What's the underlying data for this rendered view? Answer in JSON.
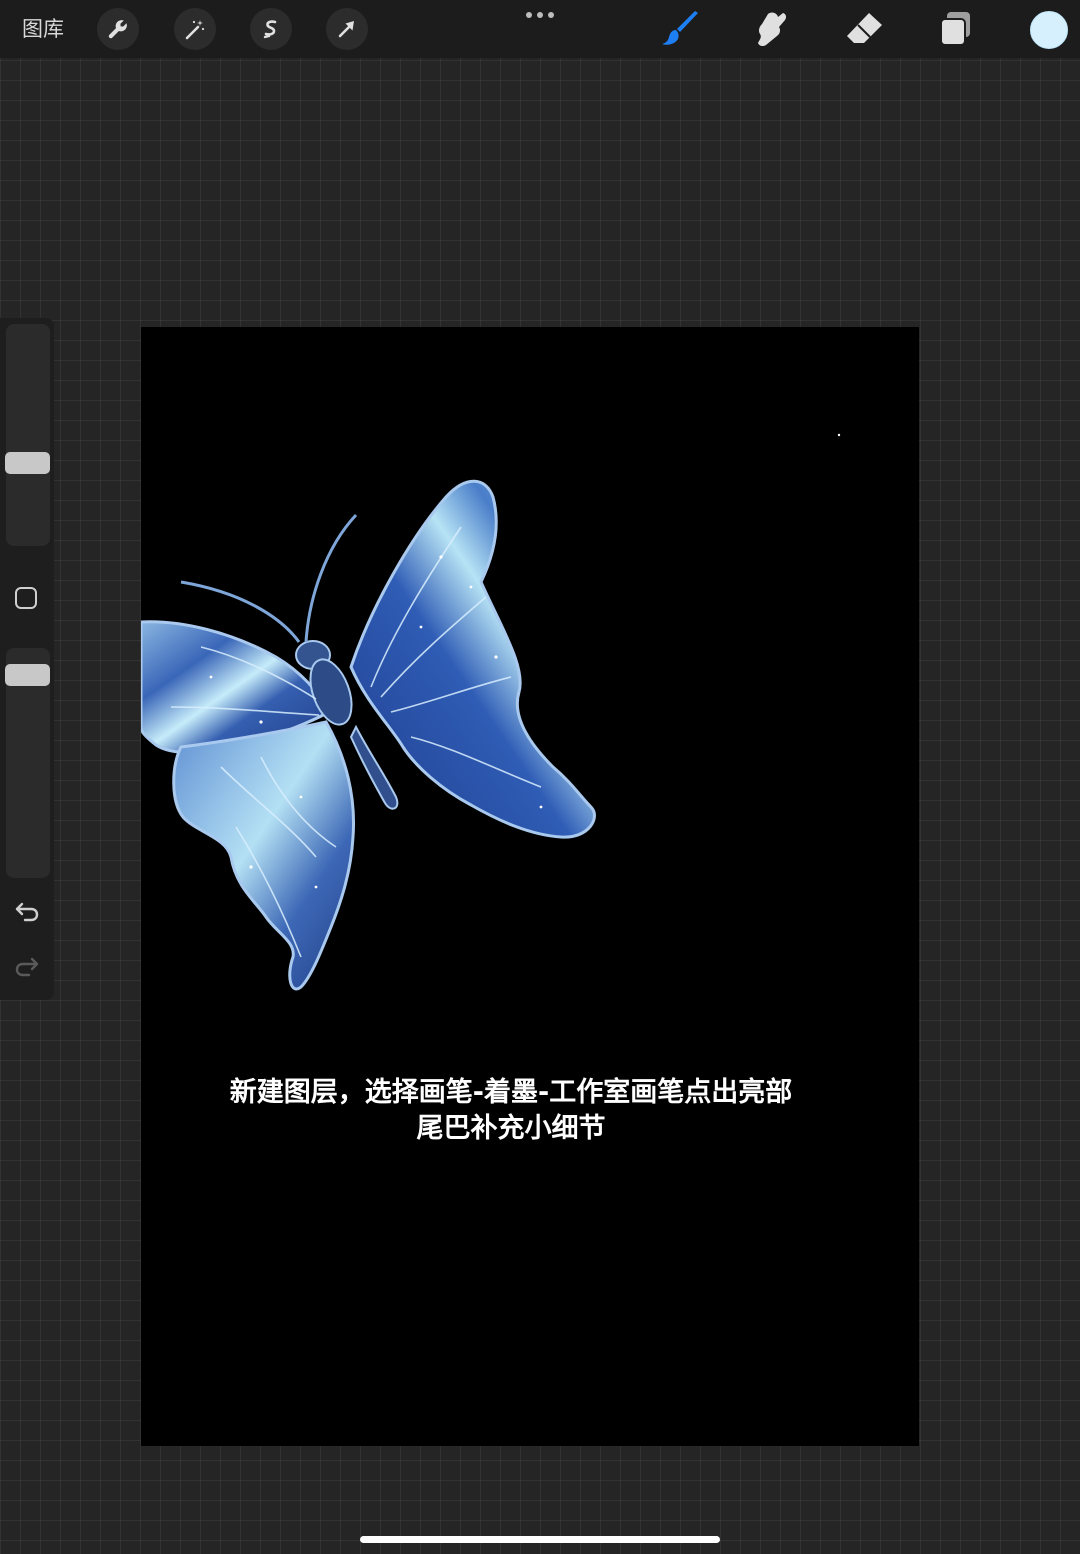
{
  "toolbar": {
    "gallery_label": "图库",
    "left_tools": [
      {
        "icon": "wrench-icon",
        "name": "actions"
      },
      {
        "icon": "magic-wand-icon",
        "name": "adjustments"
      },
      {
        "icon": "selection-icon",
        "name": "selection"
      },
      {
        "icon": "arrow-cursor-icon",
        "name": "transform"
      }
    ],
    "more_icon": "ellipsis-icon",
    "right_tools": [
      {
        "icon": "brush-icon",
        "name": "paint",
        "active": true
      },
      {
        "icon": "smudge-icon",
        "name": "smudge",
        "active": false
      },
      {
        "icon": "eraser-icon",
        "name": "erase",
        "active": false
      },
      {
        "icon": "layers-icon",
        "name": "layers",
        "active": false
      }
    ],
    "active_color": "#d6f0fd",
    "accent_color": "#1e7ff2"
  },
  "sidebar": {
    "brush_size_level": 0.35,
    "opacity_level": 0.95,
    "modify_icon": "square-icon",
    "undo_icon": "undo-icon",
    "redo_icon": "redo-icon"
  },
  "canvas": {
    "background": "#000000",
    "artwork": "blue-butterfly",
    "caption_lines": [
      "新建图层，选择画笔-着墨-工作室画笔点出亮部",
      "尾巴补充小细节"
    ]
  }
}
